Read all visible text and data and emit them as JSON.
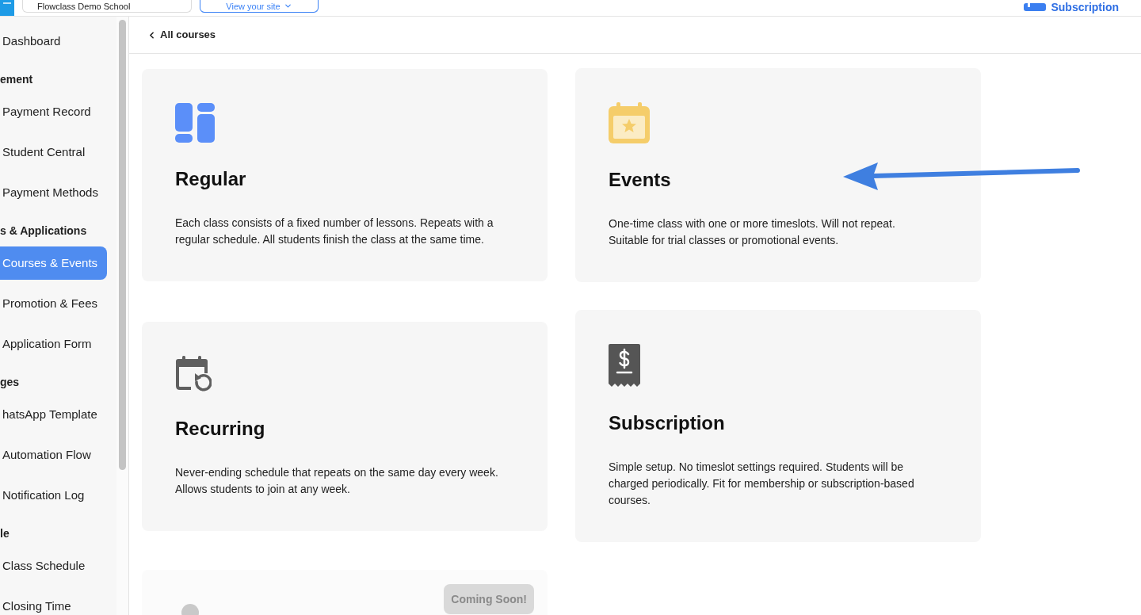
{
  "top_bar": {
    "school_field": {
      "value": "Flowclass Demo School"
    },
    "view_site_button": {
      "label": "View your site"
    },
    "subscription_link": {
      "label": "Subscription"
    }
  },
  "sidebar": {
    "items": [
      {
        "label": "Dashboard",
        "selected": false
      }
    ],
    "sections": [
      {
        "title": "ement",
        "items": [
          {
            "label": "Payment Record",
            "selected": false
          },
          {
            "label": "Student Central",
            "selected": false
          },
          {
            "label": "Payment Methods",
            "selected": false
          }
        ]
      },
      {
        "title": "s & Applications",
        "items": [
          {
            "label": "Courses & Events",
            "selected": true
          },
          {
            "label": "Promotion & Fees",
            "selected": false
          },
          {
            "label": "Application Form",
            "selected": false
          }
        ]
      },
      {
        "title": "ges",
        "items": [
          {
            "label": "hatsApp Template",
            "selected": false
          },
          {
            "label": "Automation Flow",
            "selected": false
          },
          {
            "label": "Notification Log",
            "selected": false
          }
        ]
      },
      {
        "title": "le",
        "items": [
          {
            "label": "Class Schedule",
            "selected": false
          },
          {
            "label": "Closing Time",
            "selected": false
          }
        ]
      }
    ]
  },
  "header": {
    "back_link": {
      "label": "All courses"
    }
  },
  "cards": [
    {
      "kind": "regular",
      "title": "Regular",
      "description": "Each class consists of a fixed number of lessons. Repeats with a regular schedule. All students finish the class at the same time.",
      "disabled": false
    },
    {
      "kind": "events",
      "title": "Events",
      "description": "One-time class with one or more timeslots. Will not repeat. Suitable for trial classes or promotional events.",
      "disabled": false
    },
    {
      "kind": "recurring",
      "title": "Recurring",
      "description": "Never-ending schedule that repeats on the same day every week. Allows students to join at any week.",
      "disabled": false
    },
    {
      "kind": "subscription",
      "title": "Subscription",
      "description": "Simple setup. No timeslot settings required. Students will be charged periodically. Fit for membership or subscription-based courses.",
      "disabled": false
    },
    {
      "kind": "upcoming",
      "badge": "Coming Soon!",
      "disabled": true
    }
  ]
}
